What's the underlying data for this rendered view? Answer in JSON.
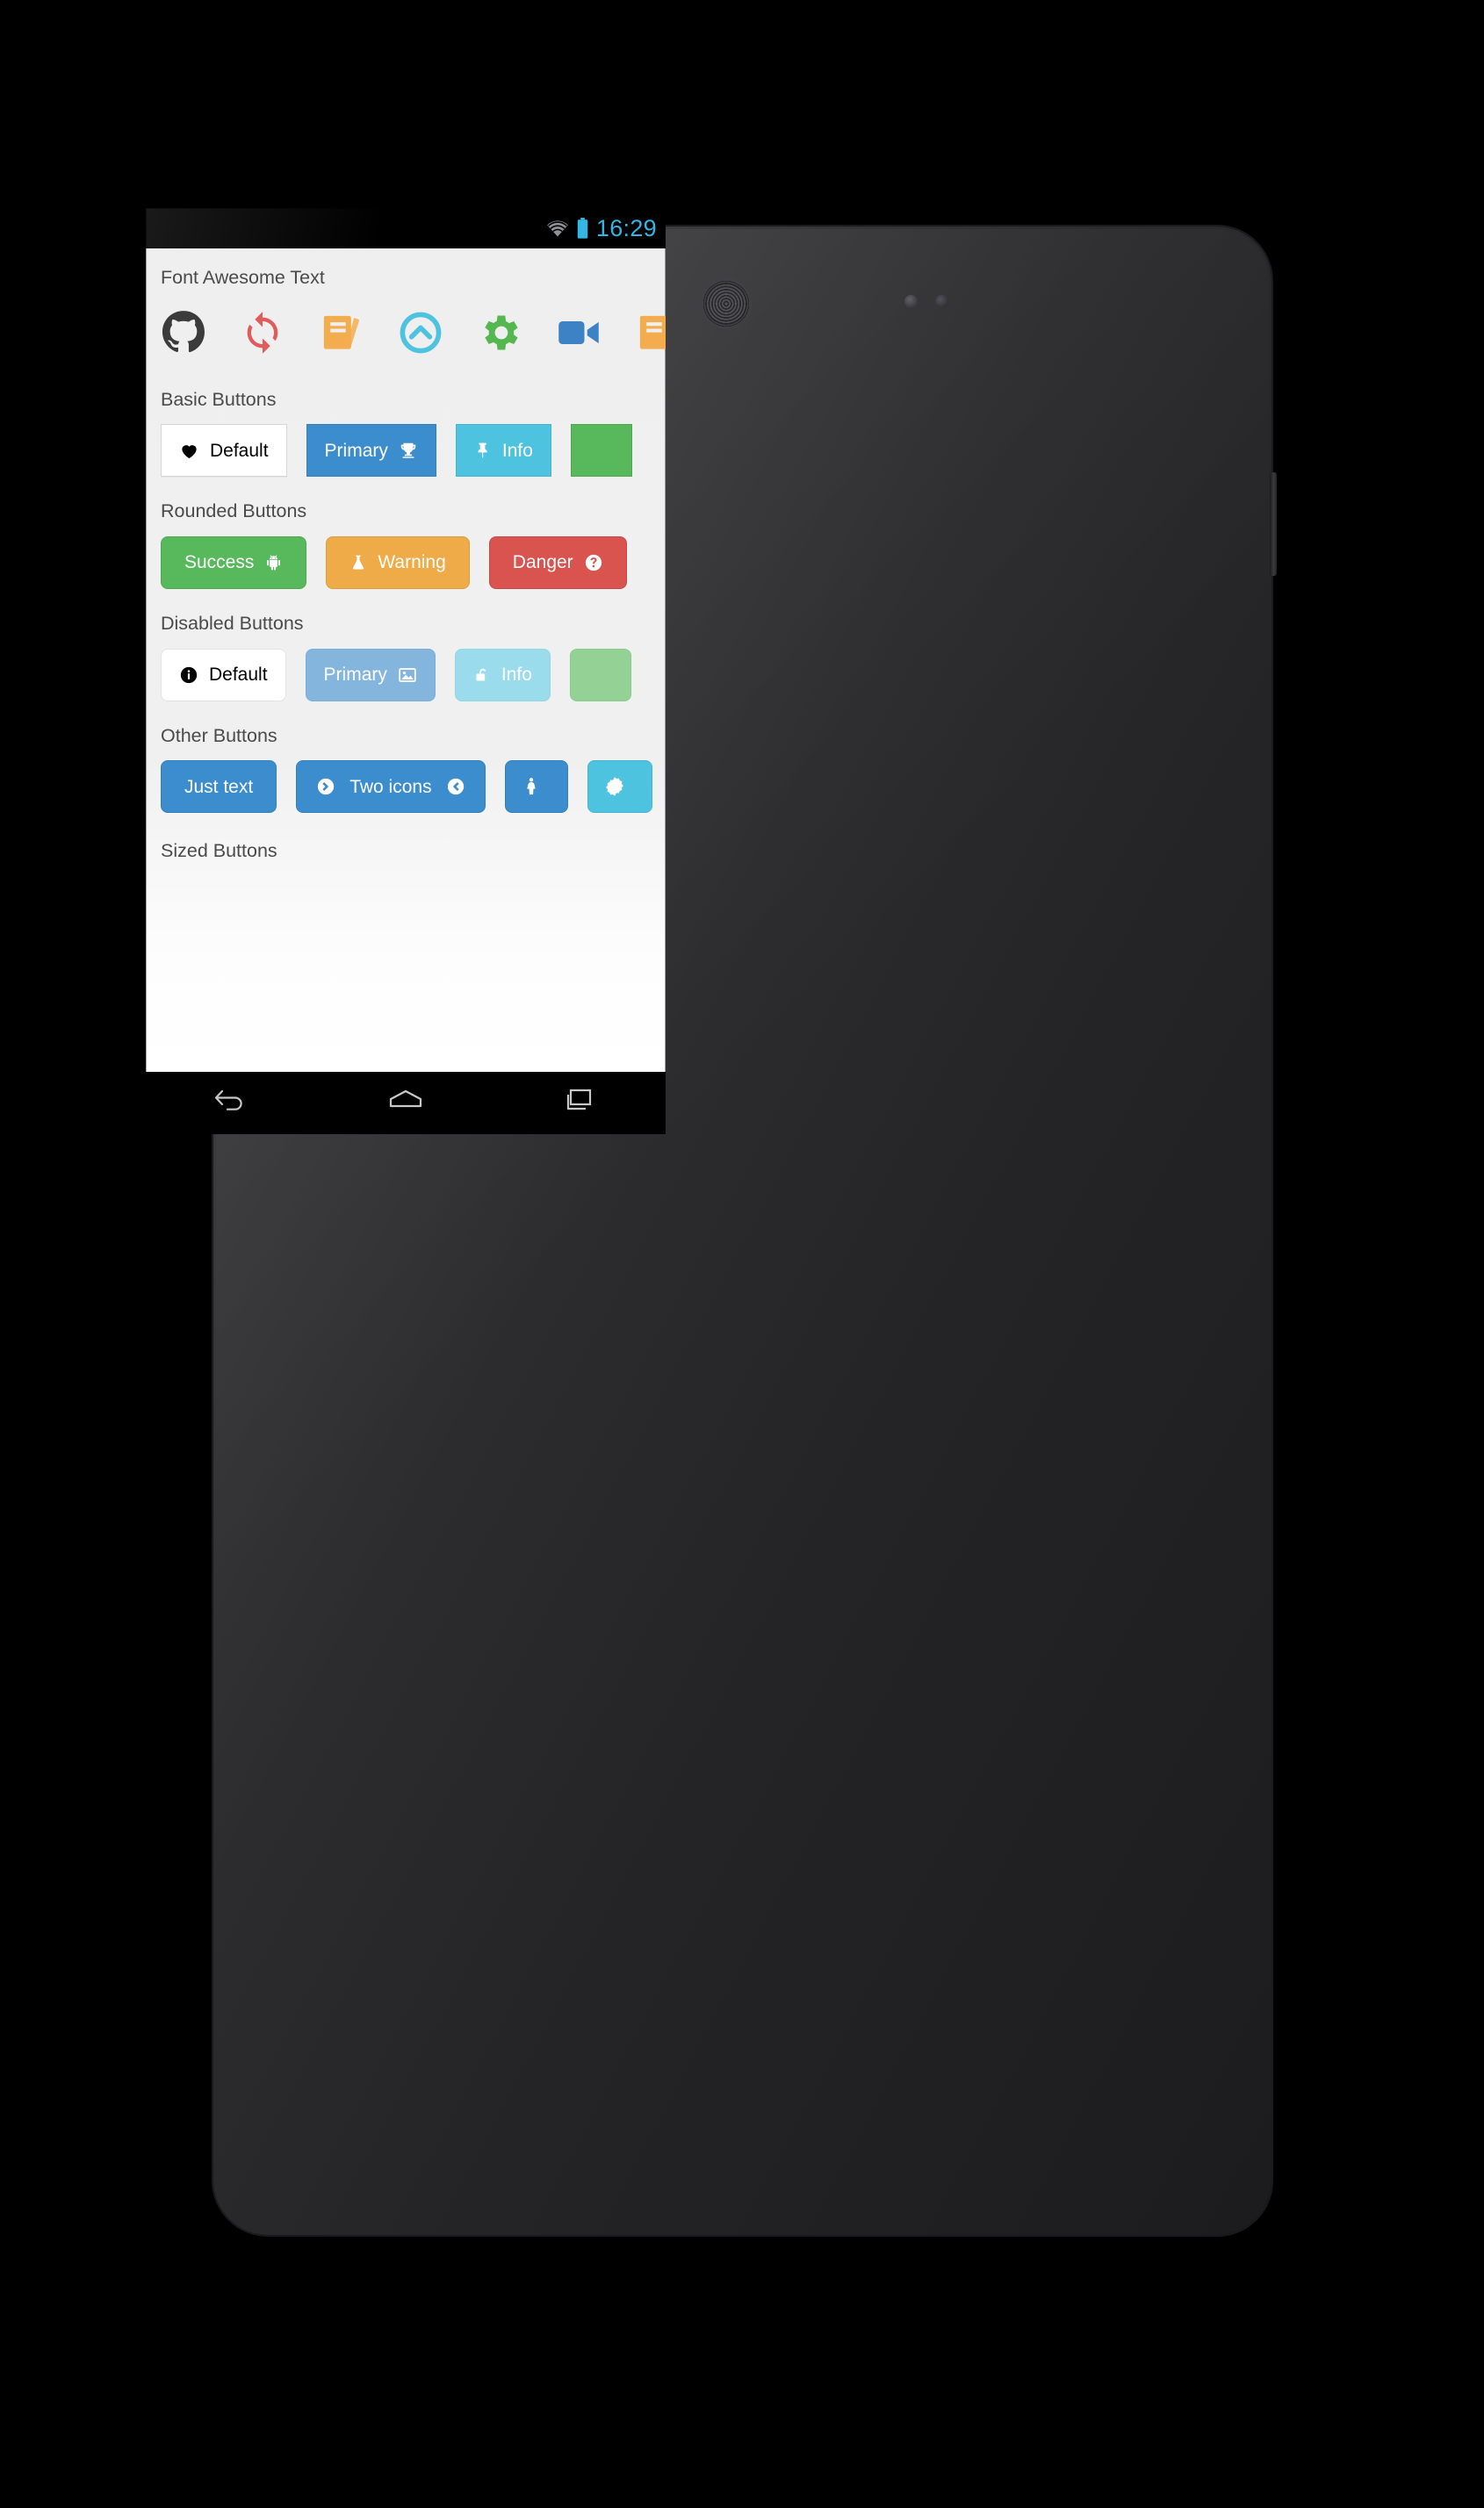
{
  "status_bar": {
    "clock": "16:29",
    "wifi_icon": "wifi-icon",
    "battery_icon": "battery-icon",
    "accent_color": "#33b5e5"
  },
  "app": {
    "sections": [
      {
        "id": "font-awesome-text",
        "title": "Font Awesome Text",
        "icons": [
          {
            "name": "github-icon",
            "color": "#3b3b3b"
          },
          {
            "name": "refresh-icon",
            "color": "#e05c5c"
          },
          {
            "name": "book-icon",
            "color": "#f3ad4e"
          },
          {
            "name": "chevron-circle-up-icon",
            "color": "#4ec3e0"
          },
          {
            "name": "cog-icon",
            "color": "#54b750"
          },
          {
            "name": "video-camera-icon",
            "color": "#3c82c4"
          },
          {
            "name": "book-icon-2",
            "color": "#f3ad4e"
          }
        ]
      },
      {
        "id": "basic-buttons",
        "title": "Basic Buttons",
        "buttons": [
          {
            "label": "Default",
            "style": "default",
            "icon_left": "heart-icon",
            "icon_right": "",
            "rounded": false,
            "disabled": false
          },
          {
            "label": "Primary",
            "style": "primary",
            "icon_left": "",
            "icon_right": "trophy-icon",
            "rounded": false,
            "disabled": false
          },
          {
            "label": "Info",
            "style": "info",
            "icon_left": "thumbtack-icon",
            "icon_right": "",
            "rounded": false,
            "disabled": false
          },
          {
            "label": "",
            "style": "success",
            "icon_left": "",
            "icon_right": "",
            "rounded": false,
            "disabled": false
          }
        ]
      },
      {
        "id": "rounded-buttons",
        "title": "Rounded Buttons",
        "buttons": [
          {
            "label": "Success",
            "style": "success",
            "icon_left": "",
            "icon_right": "android-icon",
            "rounded": true,
            "disabled": false
          },
          {
            "label": "Warning",
            "style": "warning",
            "icon_left": "flask-icon",
            "icon_right": "",
            "rounded": true,
            "disabled": false
          },
          {
            "label": "Danger",
            "style": "danger",
            "icon_left": "",
            "icon_right": "question-circle-icon",
            "rounded": true,
            "disabled": false
          }
        ]
      },
      {
        "id": "disabled-buttons",
        "title": "Disabled Buttons",
        "buttons": [
          {
            "label": "Default",
            "style": "default",
            "icon_left": "info-circle-icon",
            "icon_right": "",
            "rounded": true,
            "disabled": true
          },
          {
            "label": "Primary",
            "style": "primary",
            "icon_left": "",
            "icon_right": "picture-icon",
            "rounded": true,
            "disabled": true
          },
          {
            "label": "Info",
            "style": "info",
            "icon_left": "unlock-icon",
            "icon_right": "",
            "rounded": true,
            "disabled": true
          },
          {
            "label": "",
            "style": "success",
            "icon_left": "",
            "icon_right": "",
            "rounded": true,
            "disabled": true
          }
        ]
      },
      {
        "id": "other-buttons",
        "title": "Other Buttons",
        "buttons": [
          {
            "label": "Just text",
            "style": "primary",
            "icon_left": "",
            "icon_right": "",
            "rounded": true,
            "disabled": false
          },
          {
            "label": "Two icons",
            "style": "primary",
            "icon_left": "chevron-circle-right-icon",
            "icon_right": "chevron-circle-left-icon",
            "rounded": true,
            "disabled": false
          },
          {
            "label": "",
            "style": "primary",
            "icon_left": "female-icon",
            "icon_right": "",
            "rounded": true,
            "disabled": false
          },
          {
            "label": "",
            "style": "info",
            "icon_left": "certificate-icon",
            "icon_right": "",
            "rounded": true,
            "disabled": false
          }
        ]
      },
      {
        "id": "sized-buttons",
        "title": "Sized Buttons",
        "buttons": []
      }
    ]
  },
  "nav_bar": {
    "buttons": [
      {
        "name": "back-button",
        "icon": "back-icon"
      },
      {
        "name": "home-button",
        "icon": "home-icon"
      },
      {
        "name": "recents-button",
        "icon": "recents-icon"
      }
    ]
  },
  "colors": {
    "primary": "#3c8dcd",
    "info": "#4ec3e0",
    "success": "#58b85c",
    "warning": "#efab47",
    "danger": "#d9534f",
    "status_accent": "#33b5e5",
    "app_background": "#f0f0f0"
  }
}
